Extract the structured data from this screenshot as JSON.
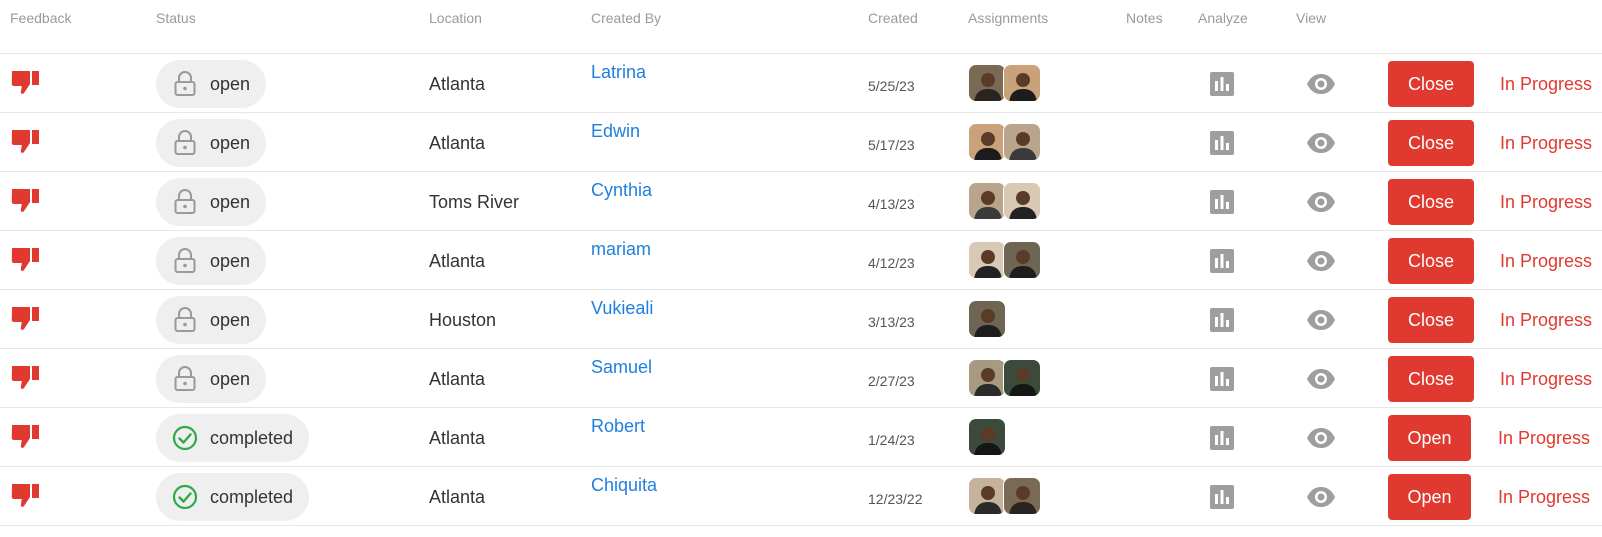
{
  "headers": {
    "feedback": "Feedback",
    "status": "Status",
    "location": "Location",
    "created_by": "Created By",
    "created": "Created",
    "assignments": "Assignments",
    "notes": "Notes",
    "analyze": "Analyze",
    "view": "View"
  },
  "colors": {
    "accent_red": "#e0392f",
    "link_blue": "#1f7fe0",
    "status_bg": "#efefef",
    "completed_green": "#2eaa4a"
  },
  "rows": [
    {
      "status": "open",
      "status_icon": "lock-icon",
      "location": "Atlanta",
      "created_by": "Latrina",
      "created": "5/25/23",
      "assignments": 2,
      "action": "Close",
      "progress": "In Progress"
    },
    {
      "status": "open",
      "status_icon": "lock-icon",
      "location": "Atlanta",
      "created_by": "Edwin",
      "created": "5/17/23",
      "assignments": 2,
      "action": "Close",
      "progress": "In Progress"
    },
    {
      "status": "open",
      "status_icon": "lock-icon",
      "location": "Toms River",
      "created_by": "Cynthia",
      "created": "4/13/23",
      "assignments": 2,
      "action": "Close",
      "progress": "In Progress"
    },
    {
      "status": "open",
      "status_icon": "lock-icon",
      "location": "Atlanta",
      "created_by": "mariam",
      "created": "4/12/23",
      "assignments": 2,
      "action": "Close",
      "progress": "In Progress"
    },
    {
      "status": "open",
      "status_icon": "lock-icon",
      "location": "Houston",
      "created_by": "Vukieali",
      "created": "3/13/23",
      "assignments": 1,
      "action": "Close",
      "progress": "In Progress"
    },
    {
      "status": "open",
      "status_icon": "lock-icon",
      "location": "Atlanta",
      "created_by": "Samuel",
      "created": "2/27/23",
      "assignments": 2,
      "action": "Close",
      "progress": "In Progress"
    },
    {
      "status": "completed",
      "status_icon": "check-circle-icon",
      "location": "Atlanta",
      "created_by": "Robert",
      "created": "1/24/23",
      "assignments": 1,
      "action": "Open",
      "progress": "In Progress"
    },
    {
      "status": "completed",
      "status_icon": "check-circle-icon",
      "location": "Atlanta",
      "created_by": "Chiquita",
      "created": "12/23/22",
      "assignments": 2,
      "action": "Open",
      "progress": "In Progress"
    }
  ]
}
